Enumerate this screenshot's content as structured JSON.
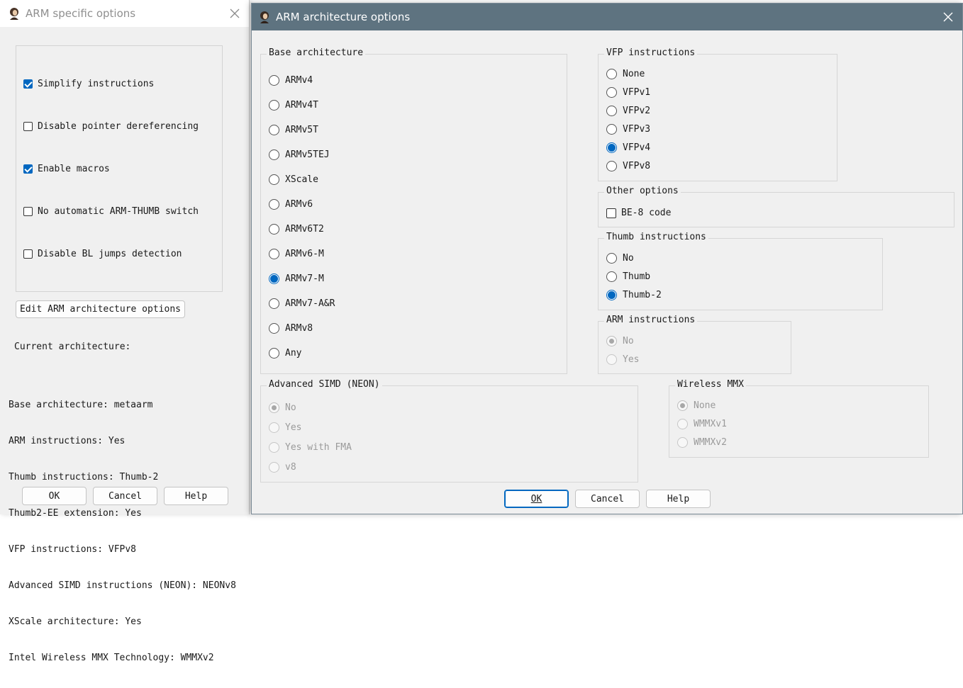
{
  "left_dialog": {
    "title": "ARM specific options",
    "checkboxes": [
      {
        "label": "Simplify instructions",
        "checked": true
      },
      {
        "label": "Disable pointer dereferencing",
        "checked": false
      },
      {
        "label": "Enable macros",
        "checked": true
      },
      {
        "label": "No automatic ARM-THUMB switch",
        "checked": false
      },
      {
        "label": "Disable BL jumps detection",
        "checked": false
      }
    ],
    "edit_button": "Edit ARM architecture options",
    "current_arch_label": "Current architecture:",
    "summary": [
      "Base architecture: metaarm",
      "ARM instructions: Yes",
      "Thumb instructions: Thumb-2",
      "Thumb2-EE extension: Yes",
      "VFP instructions: VFPv8",
      "Advanced SIMD instructions (NEON): NEONv8",
      "XScale architecture: Yes",
      "Intel Wireless MMX Technology: WMMXv2"
    ],
    "buttons": {
      "ok": "OK",
      "cancel": "Cancel",
      "help": "Help"
    }
  },
  "right_dialog": {
    "title": "ARM architecture options",
    "base_architecture": {
      "title": "Base architecture",
      "options": [
        "ARMv4",
        "ARMv4T",
        "ARMv5T",
        "ARMv5TEJ",
        "XScale",
        "ARMv6",
        "ARMv6T2",
        "ARMv6-M",
        "ARMv7-M",
        "ARMv7-A&R",
        "ARMv8",
        "Any"
      ],
      "selected": "ARMv7-M"
    },
    "vfp_instructions": {
      "title": "VFP instructions",
      "options": [
        "None",
        "VFPv1",
        "VFPv2",
        "VFPv3",
        "VFPv4",
        "VFPv8"
      ],
      "selected": "VFPv4"
    },
    "other_options": {
      "title": "Other options",
      "be8_label": "BE-8 code",
      "be8_checked": false
    },
    "thumb_instructions": {
      "title": "Thumb instructions",
      "options": [
        "No",
        "Thumb",
        "Thumb-2"
      ],
      "selected": "Thumb-2"
    },
    "arm_instructions": {
      "title": "ARM instructions",
      "options": [
        "No",
        "Yes"
      ],
      "selected": "No",
      "disabled": true
    },
    "advanced_simd": {
      "title": "Advanced SIMD (NEON)",
      "options": [
        "No",
        "Yes",
        "Yes with FMA",
        "v8"
      ],
      "selected": "No",
      "disabled": true
    },
    "wireless_mmx": {
      "title": "Wireless MMX",
      "options": [
        "None",
        "WMMXv1",
        "WMMXv2"
      ],
      "selected": "None",
      "disabled": true
    },
    "buttons": {
      "ok": "OK",
      "cancel": "Cancel",
      "help": "Help"
    }
  },
  "colors": {
    "accent": "#0067c0",
    "right_titlebar": "#5e7380",
    "dialog_bg": "#f0f0f0"
  }
}
